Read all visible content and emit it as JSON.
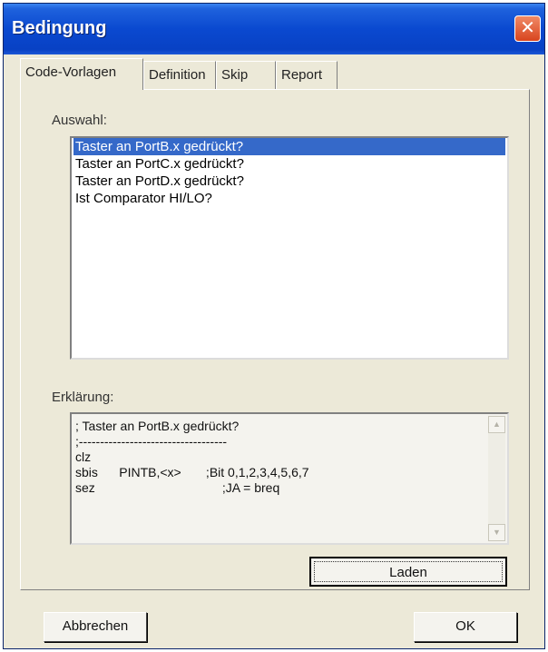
{
  "window": {
    "title": "Bedingung",
    "close_glyph": "✕"
  },
  "tabs": [
    {
      "label": "Code-Vorlagen",
      "active": true
    },
    {
      "label": "Definition",
      "active": false
    },
    {
      "label": "Skip",
      "active": false
    },
    {
      "label": "Report",
      "active": false
    }
  ],
  "auswahl": {
    "label": "Auswahl:",
    "items": [
      "Taster an PortB.x gedrückt?",
      "Taster an PortC.x gedrückt?",
      "Taster an PortD.x gedrückt?",
      "Ist Comparator HI/LO?"
    ],
    "selected_index": 0
  },
  "erklaerung": {
    "label": "Erklärung:",
    "lines": [
      "; Taster an PortB.x gedrückt?",
      ";-----------------------------------",
      "clz",
      "sbis      PINTB,<x>       ;Bit 0,1,2,3,4,5,6,7",
      "sez                                    ;JA = breq"
    ]
  },
  "buttons": {
    "laden": "Laden",
    "abbrechen": "Abbrechen",
    "ok": "OK"
  },
  "icons": {
    "scroll_up": "▲",
    "scroll_down": "▼"
  }
}
